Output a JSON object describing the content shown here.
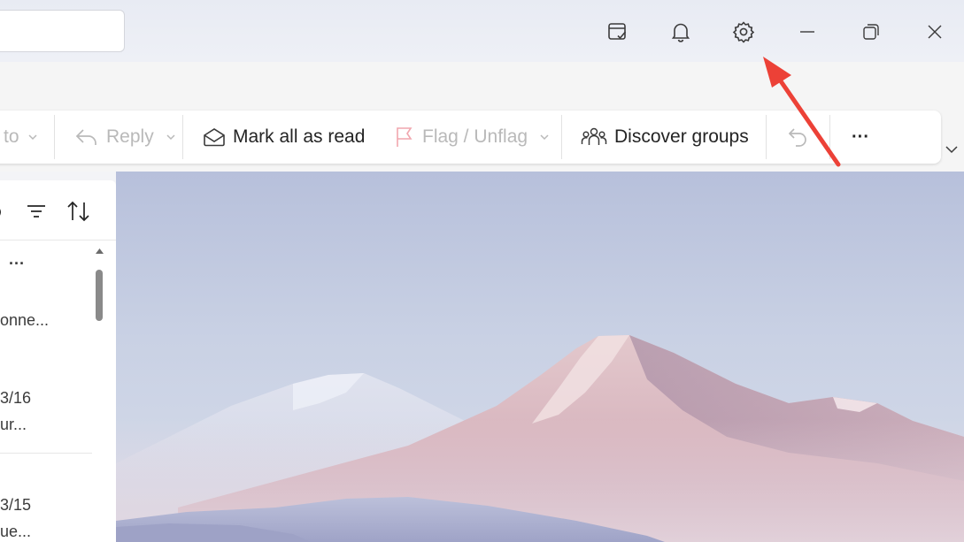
{
  "titlebar": {
    "search_value": "",
    "icons": [
      "my-day-icon",
      "bell-icon",
      "gear-icon",
      "minimize-icon",
      "restore-icon",
      "close-icon"
    ]
  },
  "ribbon": {
    "move_to_label": "to",
    "reply_label": "Reply",
    "mark_all_read_label": "Mark all as read",
    "flag_label": "Flag / Unflag",
    "discover_groups_label": "Discover groups",
    "more_label": "···"
  },
  "message_list": {
    "items": [
      {
        "top": "···",
        "mid": "onne...",
        "bot": ""
      },
      {
        "top": "",
        "mid": "3/16",
        "bot": "ur..."
      },
      {
        "top": "",
        "mid": "3/15",
        "bot": "ue..."
      }
    ]
  },
  "colors": {
    "accent": "#0f6cbd",
    "annotation_arrow": "#ec4137",
    "disabled_text": "#b9b9b9"
  }
}
